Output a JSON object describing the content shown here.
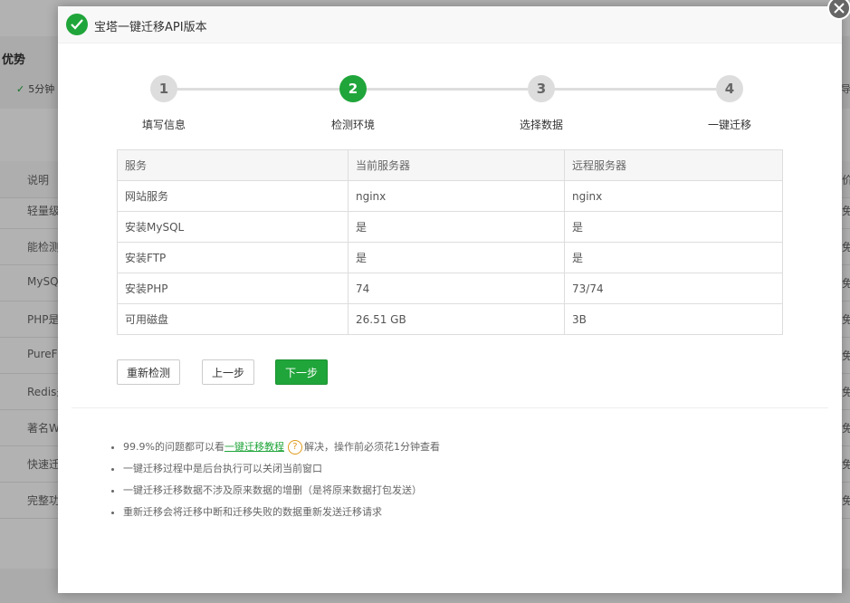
{
  "background": {
    "section_title": "优势",
    "check_text": "5分钟",
    "right_text": "导",
    "table_header": {
      "left": "说明",
      "right": "价"
    },
    "rows": [
      {
        "left": "轻量级",
        "right": "免"
      },
      {
        "left": "能检测",
        "right": "免"
      },
      {
        "left": "MySQ",
        "right": "免"
      },
      {
        "left": "PHP是",
        "right": "免"
      },
      {
        "left": "PureF",
        "right": "免"
      },
      {
        "left": "Redis是",
        "right": "免"
      },
      {
        "left": "著名W",
        "right": "免"
      },
      {
        "left": "快速迁",
        "right": "免"
      },
      {
        "left": "完整功",
        "right": "免"
      }
    ]
  },
  "modal": {
    "title": "宝塔一键迁移API版本",
    "accent_color": "#20a53a",
    "steps": [
      {
        "number": "1",
        "label": "填写信息",
        "active": false
      },
      {
        "number": "2",
        "label": "检测环境",
        "active": true
      },
      {
        "number": "3",
        "label": "选择数据",
        "active": false
      },
      {
        "number": "4",
        "label": "一键迁移",
        "active": false
      }
    ],
    "table": {
      "headers": [
        "服务",
        "当前服务器",
        "远程服务器"
      ],
      "rows": [
        [
          "网站服务",
          "nginx",
          "nginx"
        ],
        [
          "安装MySQL",
          "是",
          "是"
        ],
        [
          "安装FTP",
          "是",
          "是"
        ],
        [
          "安装PHP",
          "74",
          "73/74"
        ],
        [
          "可用磁盘",
          "26.51 GB",
          "3B"
        ]
      ]
    },
    "buttons": {
      "recheck": "重新检测",
      "prev": "上一步",
      "next": "下一步"
    },
    "tips": {
      "t1_before": "99.9%的问题都可以看",
      "t1_link": "一键迁移教程",
      "t1_help": "?",
      "t1_after": "解决，操作前必须花1分钟查看",
      "t2": "一键迁移过程中是后台执行可以关闭当前窗口",
      "t3": "一键迁移迁移数据不涉及原来数据的增删（是将原来数据打包发送）",
      "t4": "重新迁移会将迁移中断和迁移失败的数据重新发送迁移请求"
    }
  }
}
